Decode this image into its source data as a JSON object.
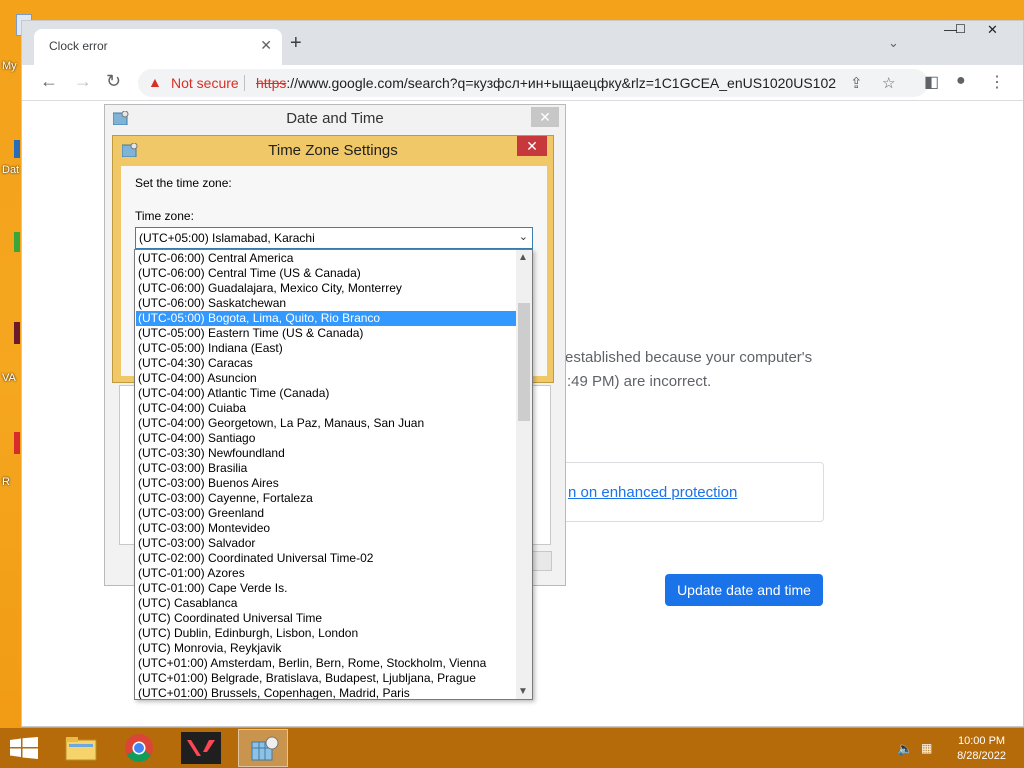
{
  "desktop": {
    "labels": [
      "My",
      "Dat",
      "VA",
      "R"
    ]
  },
  "browser": {
    "tab_title": "Clock error",
    "new_tab": "+",
    "tab_close": "✕",
    "tab_search": "⌄",
    "minimize": "—",
    "maximize": "☐",
    "close": "✕",
    "not_secure": "Not secure",
    "url_scheme": "https",
    "url_rest": "://www.google.com/search?q=кузфсл+ин+ыщаецфку&rlz=1C1GCEA_enUS1020US102..."
  },
  "page": {
    "line1": "established because your computer's",
    "line2": ":49 PM) are incorrect.",
    "enhanced_link": "n on enhanced protection",
    "update_button": "Update date and time"
  },
  "date_time_dialog": {
    "title": "Date and Time",
    "close": "✕"
  },
  "tz_dialog": {
    "title": "Time Zone Settings",
    "close": "✕",
    "set_label": "Set the time zone:",
    "tz_label": "Time zone:",
    "selected_value": "(UTC+05:00) Islamabad, Karachi"
  },
  "tz_options": [
    "(UTC-06:00) Central America",
    "(UTC-06:00) Central Time (US & Canada)",
    "(UTC-06:00) Guadalajara, Mexico City, Monterrey",
    "(UTC-06:00) Saskatchewan",
    "(UTC-05:00) Bogota, Lima, Quito, Rio Branco",
    "(UTC-05:00) Eastern Time (US & Canada)",
    "(UTC-05:00) Indiana (East)",
    "(UTC-04:30) Caracas",
    "(UTC-04:00) Asuncion",
    "(UTC-04:00) Atlantic Time (Canada)",
    "(UTC-04:00) Cuiaba",
    "(UTC-04:00) Georgetown, La Paz, Manaus, San Juan",
    "(UTC-04:00) Santiago",
    "(UTC-03:30) Newfoundland",
    "(UTC-03:00) Brasilia",
    "(UTC-03:00) Buenos Aires",
    "(UTC-03:00) Cayenne, Fortaleza",
    "(UTC-03:00) Greenland",
    "(UTC-03:00) Montevideo",
    "(UTC-03:00) Salvador",
    "(UTC-02:00) Coordinated Universal Time-02",
    "(UTC-01:00) Azores",
    "(UTC-01:00) Cape Verde Is.",
    "(UTC) Casablanca",
    "(UTC) Coordinated Universal Time",
    "(UTC) Dublin, Edinburgh, Lisbon, London",
    "(UTC) Monrovia, Reykjavik",
    "(UTC+01:00) Amsterdam, Berlin, Bern, Rome, Stockholm, Vienna",
    "(UTC+01:00) Belgrade, Bratislava, Budapest, Ljubljana, Prague",
    "(UTC+01:00) Brussels, Copenhagen, Madrid, Paris"
  ],
  "tz_highlighted_index": 4,
  "taskbar": {
    "time": "10:00 PM",
    "date": "8/28/2022",
    "start_icon": "windows-icon"
  }
}
